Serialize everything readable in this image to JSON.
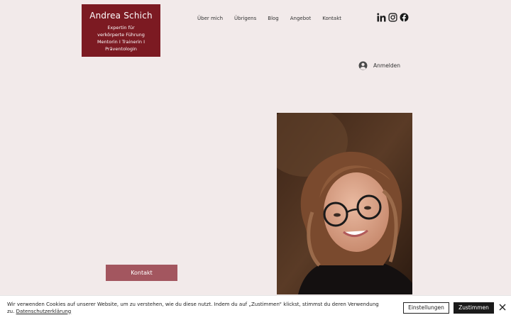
{
  "logo": {
    "name": "Andrea Schich",
    "tagline_lines": [
      "Expertin für",
      "verkörperte Führung",
      "Mentorin I Trainerin I",
      "Präventologin"
    ]
  },
  "nav": {
    "items": [
      "Über mich",
      "Übrigens",
      "Blog",
      "Angebot",
      "Kontakt"
    ]
  },
  "social": {
    "icons": [
      "linkedin-icon",
      "instagram-icon",
      "facebook-icon"
    ]
  },
  "login": {
    "label": "Anmelden"
  },
  "hero": {
    "contact_button": "Kontakt"
  },
  "cookie": {
    "text": "Wir verwenden Cookies auf unserer Website, um zu verstehen, wie du diese nutzt. Indem du auf „Zustimmen“ klickst, stimmst du deren Verwendung zu.",
    "link": "Datenschutzerklärung",
    "settings_button": "Einstellungen",
    "accept_button": "Zustimmen"
  },
  "colors": {
    "brand": "#7c1a22",
    "button": "#a3565f",
    "background": "#f2eaea"
  }
}
